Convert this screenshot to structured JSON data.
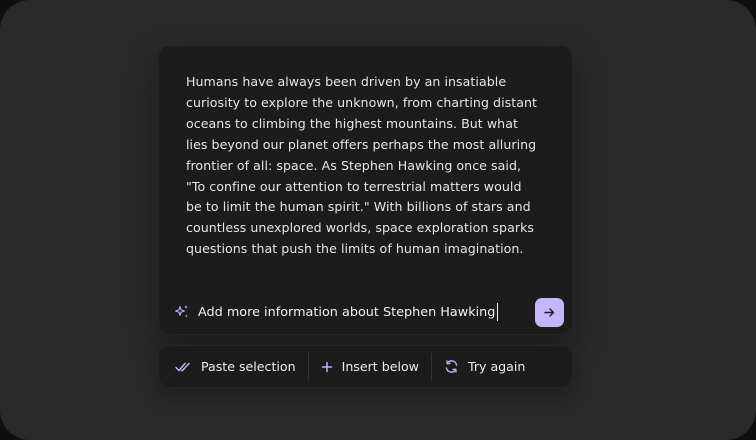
{
  "panel": {
    "body_lines": [
      "Humans have always been driven by an insatiable",
      "curiosity to explore the unknown, from charting distant",
      "oceans to climbing the highest mountains. But what",
      "lies beyond our planet offers perhaps the most alluring",
      "frontier of all: space. As Stephen Hawking once said,",
      "\"To confine our attention to terrestrial matters would",
      "be to limit the human spirit.\" With billions of stars and",
      "countless unexplored worlds, space exploration sparks",
      "questions that push the limits of human imagination."
    ]
  },
  "prompt": {
    "value": "Add more information about Stephen Hawking",
    "icon": "sparkle-icon",
    "send_icon": "arrow-right-icon"
  },
  "actions": [
    {
      "label": "Paste selection",
      "icon": "double-check-icon"
    },
    {
      "label": "Insert below",
      "icon": "plus-icon"
    },
    {
      "label": "Try again",
      "icon": "refresh-icon"
    }
  ],
  "colors": {
    "accent": "#c4b5fd",
    "panel_bg": "#1c1c1c",
    "frame_bg": "#2a2a2a"
  }
}
